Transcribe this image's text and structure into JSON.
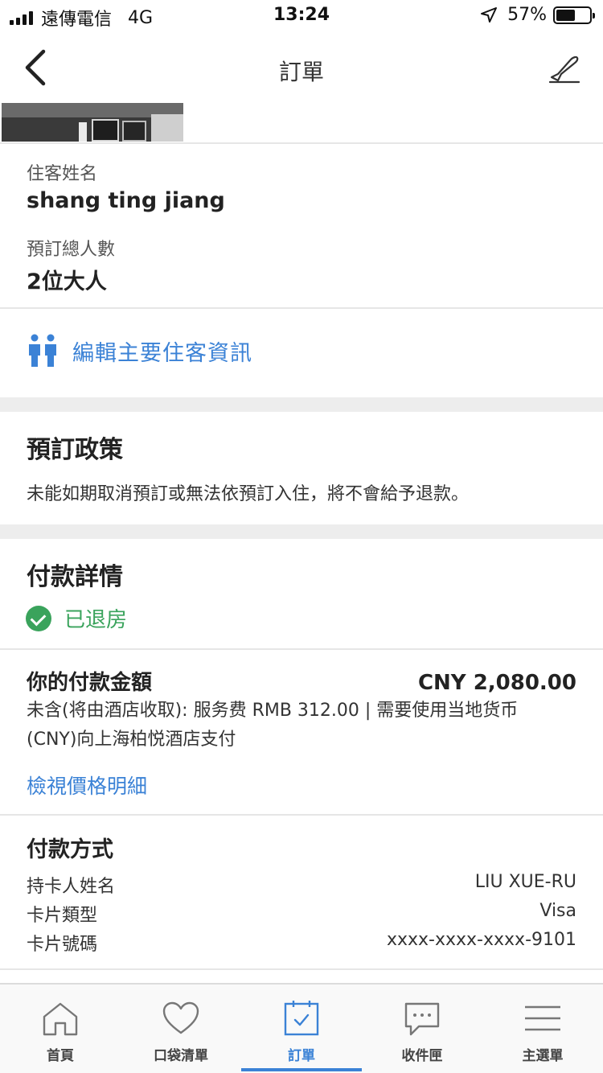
{
  "status_bar": {
    "carrier": "遠傳電信",
    "network": "4G",
    "time": "13:24",
    "battery": "57%",
    "battery_level": 0.57
  },
  "nav": {
    "title": "訂單",
    "back_icon": "chevron-left-icon",
    "right_icon": "airplane-icon"
  },
  "guest": {
    "name_label": "住客姓名",
    "name_value": "shang ting jiang",
    "count_label": "預訂總人數",
    "count_value": "2位大人",
    "edit_link": "編輯主要住客資訊"
  },
  "policy": {
    "title": "預訂政策",
    "text": "未能如期取消預訂或無法依預訂入住，將不會給予退款。"
  },
  "payment": {
    "title": "付款詳情",
    "status": "已退房",
    "amount_label": "你的付款金額",
    "amount_value": "CNY 2,080.00",
    "note_line1": "未含(将由酒店收取): 服务费 RMB 312.00 | 需要使用当地货币",
    "note_line2": "(CNY)向上海柏悦酒店支付",
    "price_link": "檢視價格明細"
  },
  "method": {
    "title": "付款方式",
    "rows": [
      {
        "label": "持卡人姓名",
        "value": "LIU XUE-RU"
      },
      {
        "label": "卡片類型",
        "value": "Visa"
      },
      {
        "label": "卡片號碼",
        "value": "xxxx-xxxx-xxxx-9101"
      }
    ]
  },
  "tabs": [
    {
      "label": "首頁",
      "icon": "home-icon"
    },
    {
      "label": "口袋清單",
      "icon": "heart-icon"
    },
    {
      "label": "訂單",
      "icon": "calendar-check-icon"
    },
    {
      "label": "收件匣",
      "icon": "chat-bubble-icon"
    },
    {
      "label": "主選單",
      "icon": "menu-icon"
    }
  ],
  "colors": {
    "accent": "#3b82d6",
    "success": "#3aa35c",
    "divider_band": "#ededed"
  }
}
